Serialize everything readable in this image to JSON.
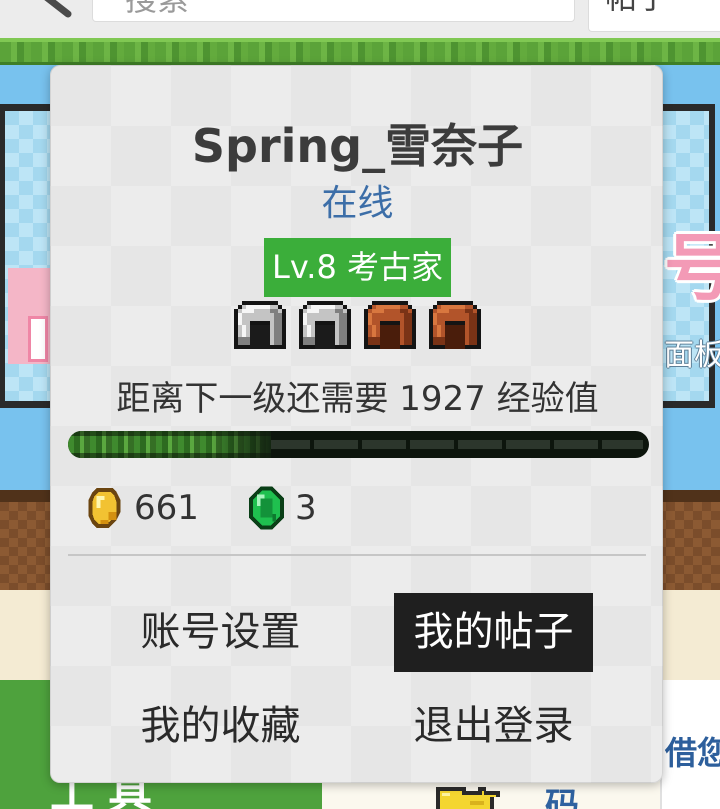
{
  "top_bar": {
    "search_placeholder": "搜索",
    "scope_select": "帖子"
  },
  "background": {
    "banner_title": "号",
    "banner_caption": "面板",
    "tools_label": "工具",
    "right_text": "借您",
    "bottom_text": "码"
  },
  "profile_card": {
    "username": "Spring_雪奈子",
    "status": "在线",
    "level_badge": "Lv.8 考古家",
    "level_icons": [
      "iron-helmet-icon",
      "iron-helmet-icon",
      "leather-helmet-icon",
      "leather-helmet-icon"
    ],
    "exp": {
      "text": "距离下一级还需要 1927 经验值",
      "progress": 0.35
    },
    "currency": {
      "gold": {
        "icon": "gold-nugget-icon",
        "value": "661"
      },
      "emerald": {
        "icon": "emerald-icon",
        "value": "3"
      }
    },
    "menu": [
      {
        "label": "账号设置",
        "active": false
      },
      {
        "label": "我的帖子",
        "active": true
      },
      {
        "label": "我的收藏",
        "active": false
      },
      {
        "label": "退出登录",
        "active": false
      }
    ]
  },
  "colors": {
    "badge_bg": "#3bae3a",
    "status_text": "#3c6ea8",
    "active_menu_bg": "#1f1f1f"
  }
}
